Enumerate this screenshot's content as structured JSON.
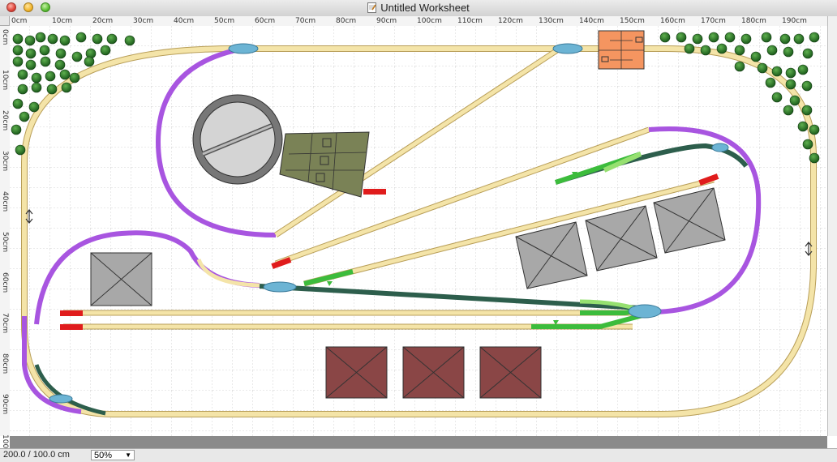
{
  "window": {
    "title": "Untitled Worksheet"
  },
  "ruler": {
    "horizontal": [
      "0cm",
      "10cm",
      "20cm",
      "30cm",
      "40cm",
      "50cm",
      "60cm",
      "70cm",
      "80cm",
      "90cm",
      "100cm",
      "110cm",
      "120cm",
      "130cm",
      "140cm",
      "150cm",
      "160cm",
      "170cm",
      "180cm",
      "190cm"
    ],
    "vertical": [
      "0cm",
      "10cm",
      "20cm",
      "30cm",
      "40cm",
      "50cm",
      "60cm",
      "70cm",
      "80cm",
      "90cm",
      "100"
    ]
  },
  "status": {
    "dimensions": "200.0 / 100.0 cm",
    "zoom": "50%"
  },
  "colors": {
    "track": "#f4e4a8",
    "track_edge": "#b89e58",
    "curve_track": "#a855e0",
    "dark_track": "#2d5e4c",
    "green_track": "#3cbc3c",
    "light_green_track": "#96e070",
    "switch": "#6cb4d4",
    "buffer": "#e01c1c",
    "tree": "#1f6b1f",
    "roof_gray": "#a8a8a8",
    "roof_brown": "#8a4646",
    "station": "#f59560",
    "turntable_pit": "#7a8256",
    "grid": "#c8c8c8"
  }
}
